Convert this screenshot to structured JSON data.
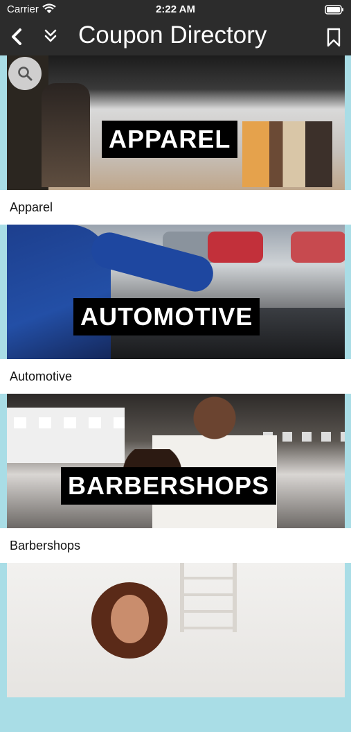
{
  "status_bar": {
    "carrier": "Carrier",
    "time": "2:22 AM"
  },
  "nav": {
    "title": "Coupon Directory"
  },
  "colors": {
    "bar": "#2c2c2c",
    "accent_edge": "#a9dde6"
  },
  "icons": [
    "wifi-icon",
    "battery-icon",
    "back-chevron-icon",
    "double-chevron-down-icon",
    "bookmark-icon",
    "search-icon"
  ],
  "categories": [
    {
      "banner_text": "APPAREL",
      "caption": "Apparel"
    },
    {
      "banner_text": "AUTOMOTIVE",
      "caption": "Automotive"
    },
    {
      "banner_text": "BARBERSHOPS",
      "caption": "Barbershops"
    },
    {
      "banner_text": "",
      "caption": ""
    }
  ]
}
